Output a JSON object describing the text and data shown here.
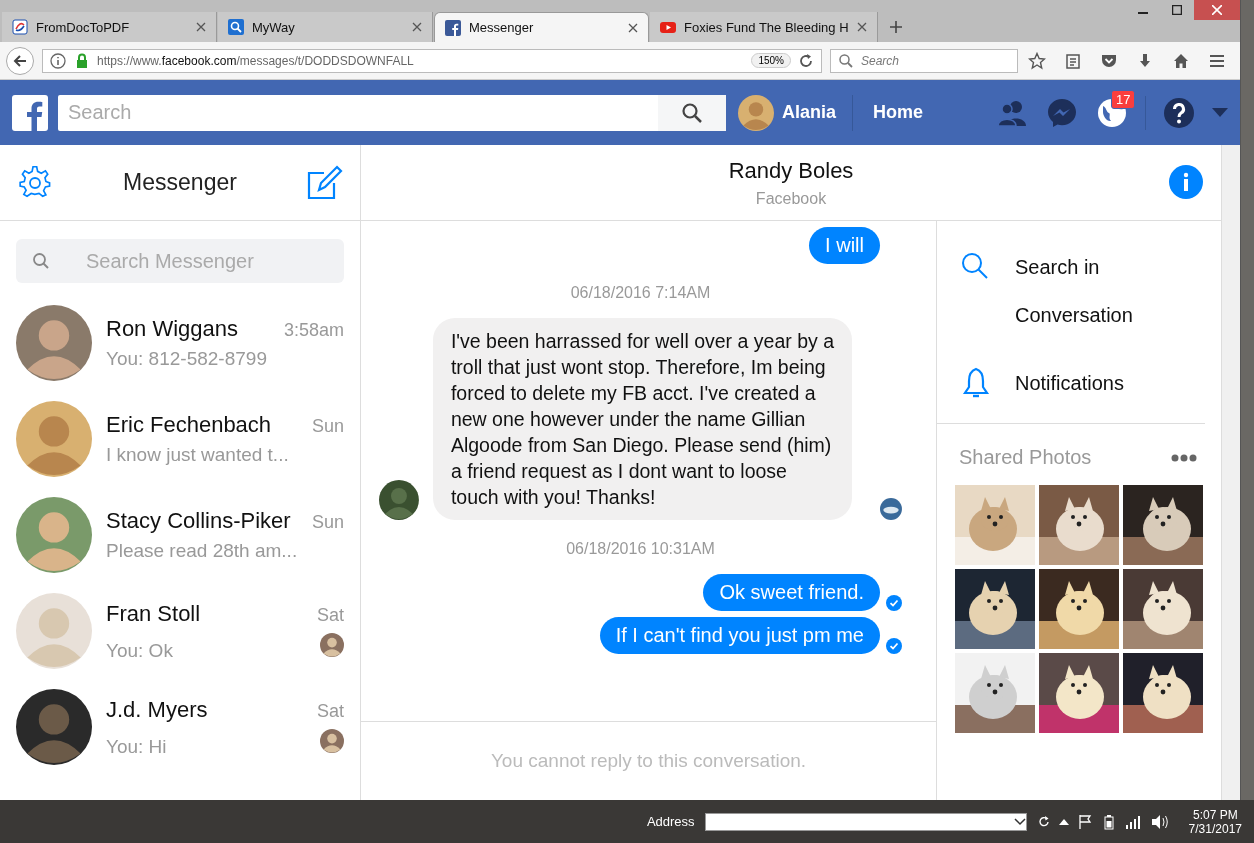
{
  "browser": {
    "tabs": [
      {
        "title": "FromDocToPDF",
        "selected": false
      },
      {
        "title": "MyWay",
        "selected": false
      },
      {
        "title": "Messenger",
        "selected": true
      },
      {
        "title": "Foxies Fund The Bleeding H",
        "selected": false
      }
    ],
    "url_prefix": "https://www.",
    "url_domain": "facebook.com",
    "url_path": "/messages/t/DODDSDOWNFALL",
    "zoom": "150%",
    "search_placeholder": "Search"
  },
  "facebook": {
    "search_placeholder": "Search",
    "user": "Alania",
    "home": "Home",
    "notifications": "17"
  },
  "sidebar": {
    "title": "Messenger",
    "search_placeholder": "Search Messenger",
    "conversations": [
      {
        "name": "Ron Wiggans",
        "time": "3:58am",
        "snippet": "You: 812-582-8799",
        "seen": false
      },
      {
        "name": "Eric Fechenbach",
        "time": "Sun",
        "snippet": "I know just wanted t...",
        "seen": false
      },
      {
        "name": "Stacy Collins-Piker",
        "time": "Sun",
        "snippet": "Please read 28th am...",
        "seen": false
      },
      {
        "name": "Fran Stoll",
        "time": "Sat",
        "snippet": "You: Ok",
        "seen": true
      },
      {
        "name": "J.d. Myers",
        "time": "Sat",
        "snippet": "You: Hi",
        "seen": true
      }
    ]
  },
  "conversation": {
    "name": "Randy Boles",
    "subtitle": "Facebook",
    "messages": [
      {
        "kind": "outgoing",
        "text": "I will",
        "delivered": false
      },
      {
        "kind": "timestamp",
        "text": "06/18/2016 7:14AM"
      },
      {
        "kind": "incoming",
        "text": "I've been harrassed for well over a year by a troll that just wont stop.  Therefore, Im being forced to delete my FB acct.  I've created a new one however under the name Gillian Algoode from San Diego.  Please send (him) a friend request as I dont want to loose touch with you!  Thanks!",
        "seen": true
      },
      {
        "kind": "timestamp",
        "text": "06/18/2016 10:31AM"
      },
      {
        "kind": "outgoing",
        "text": "Ok sweet friend.",
        "delivered": true
      },
      {
        "kind": "outgoing",
        "text": "If I can't find you just pm me",
        "delivered": true
      }
    ],
    "composer_notice": "You cannot reply to this conversation."
  },
  "details": {
    "actions": [
      {
        "kind": "search",
        "label": "Search in Conversation"
      },
      {
        "kind": "bell",
        "label": "Notifications"
      }
    ],
    "shared_title": "Shared Photos"
  },
  "taskbar": {
    "address_label": "Address",
    "time": "5:07 PM",
    "date": "7/31/2017"
  }
}
